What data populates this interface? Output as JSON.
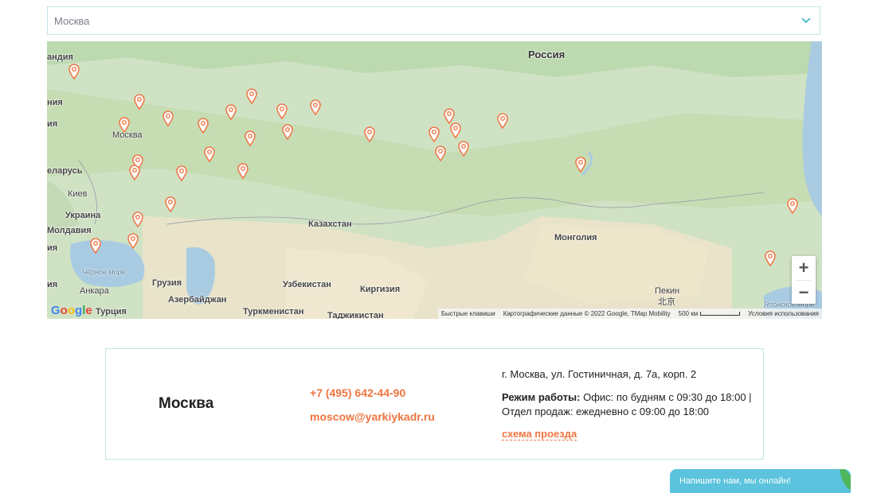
{
  "city_select": {
    "value": "Москва",
    "icon": "chevron-down-icon",
    "accent_color": "#3bb6c4"
  },
  "map": {
    "labels": {
      "russia": "Россия",
      "finland": "андия",
      "sweden": "ния",
      "latvia": "ия",
      "moscow": "Москва",
      "belarus": "еларусь",
      "kyiv": "Киев",
      "ukraine": "Украина",
      "moldova": "Молдавия",
      "romania": "ия",
      "bulgaria": "ия",
      "black_sea": "Чёрное море",
      "ankara": "Анкара",
      "turkey": "Турция",
      "georgia": "Грузия",
      "azerbaijan": "Азербайджан",
      "kazakhstan": "Казахстан",
      "uzbekistan": "Узбекистан",
      "kyrgyzstan": "Киргизия",
      "turkmenistan": "Туркменистан",
      "tajikistan": "Таджикистан",
      "mongolia": "Монголия",
      "beijing": "Пекин",
      "beijing_cn": "北京",
      "japan_sea": "Японское море"
    },
    "marker_color": "#ef7a4a",
    "marker_count": 31,
    "zoom_in": "+",
    "zoom_out": "−",
    "google_logo": "Google",
    "attribution": {
      "shortcuts": "Быстрые клавиши",
      "data": "Картографические данные © 2022 Google, TMap Mobility",
      "scale": "500 км",
      "terms": "Условия использования"
    }
  },
  "office": {
    "city": "Москва",
    "phone": "+7 (495) 642-44-90",
    "email": "moscow@yarkiykadr.ru",
    "address": "г. Москва, ул. Гостиничная, д. 7а, корп. 2",
    "hours_label": "Режим работы:",
    "hours_text": "Офис: по будням с 09:30 до 18:00 | Отдел продаж: ежедневно с 09:00 до 18:00",
    "route_link": "схема проезда"
  },
  "chat": {
    "label": "Напишите нам, мы онлайн!",
    "color": "#5bc3dd"
  }
}
